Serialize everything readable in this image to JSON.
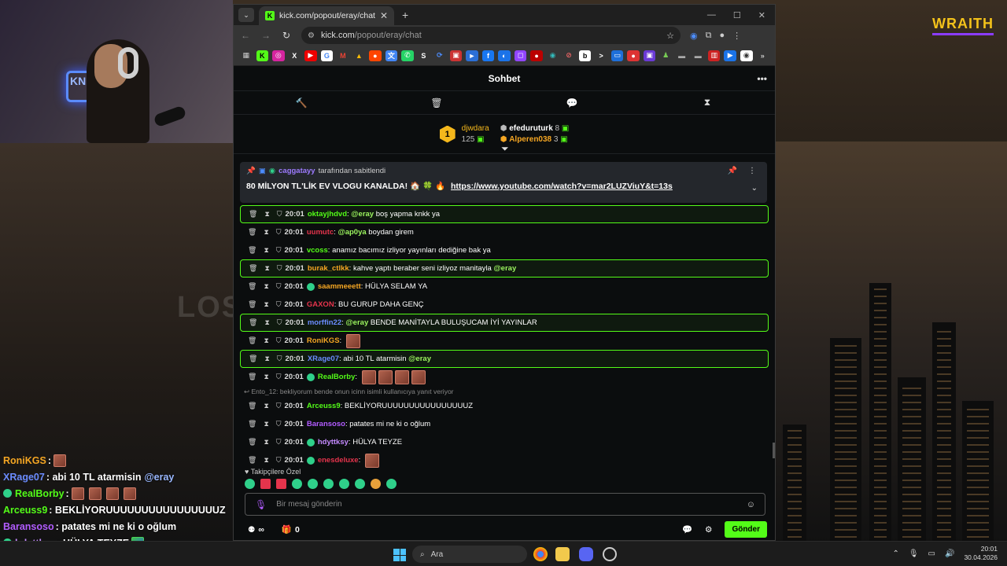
{
  "brand": "WRAITH",
  "overlay_chat": [
    {
      "user": "RoniKGS",
      "color": "#f5a623",
      "text": ":",
      "emotes": 1,
      "badge": false
    },
    {
      "user": "XRage07",
      "color": "#6b8cff",
      "text": ": abi 10 TL atarmisin",
      "mention": "@eray",
      "badge": false
    },
    {
      "user": "RealBorby",
      "color": "#53fc18",
      "text": ":",
      "emotes": 4,
      "badge": true
    },
    {
      "user": "Arceuss9",
      "color": "#53fc18",
      "text": ": BEKLİYORUUUUUUUUUUUUUUUUZ",
      "badge": false
    },
    {
      "user": "Baransoso",
      "color": "#b25cff",
      "text": ": patates mi ne ki o oğlum",
      "badge": false
    },
    {
      "user": "hdyttksy",
      "color": "#c58bff",
      "text": ": HÜLYA TEYZE",
      "frog": true,
      "badge": true
    },
    {
      "user": "enesdeluxe",
      "color": "#e5344c",
      "text": ":",
      "emotes": 1,
      "badge": true
    }
  ],
  "browser": {
    "tab_title": "kick.com/popout/eray/chat",
    "url_host": "kick.com",
    "url_path": "/popout/eray/chat"
  },
  "chat": {
    "title": "Sohbet",
    "leaderboard": {
      "first": {
        "rank": "1",
        "name": "djwdara",
        "count": "125"
      },
      "second": {
        "name": "efeduruturk",
        "count": "8"
      },
      "third": {
        "name": "Alperen038",
        "count": "3"
      }
    },
    "pinned": {
      "by_user": "caggatayy",
      "by_text": "tarafından sabitlendi",
      "message": "80 MİLYON TL'LİK EV VLOGU KANALDA! 🏠 🍀 🔥",
      "link": "https://www.youtube.com/watch?v=mar2LUZViuY&t=13s"
    },
    "messages": [
      {
        "time": "20:01",
        "user": "oktayjhdvd",
        "color": "#53fc18",
        "mention": "@eray",
        "text": "boş yapma knkk ya",
        "hl": true
      },
      {
        "time": "20:01",
        "user": "uumutc",
        "color": "#e5344c",
        "mention": "@ap0ya",
        "text": "boydan girem",
        "hl": false
      },
      {
        "time": "20:01",
        "user": "vcoss",
        "color": "#53fc18",
        "mention": "",
        "text": "anamız bacımız izliyor yayınları dediğine bak ya",
        "hl": false
      },
      {
        "time": "20:01",
        "user": "burak_ctlkk",
        "color": "#f5a623",
        "mention": "",
        "text": "kahve yaptı beraber seni izliyoz manitayla",
        "mention_end": "@eray",
        "hl": true
      },
      {
        "time": "20:01",
        "user": "saammeeett",
        "color": "#f5a623",
        "mention": "",
        "text": "HÜLYA SELAM YA",
        "badge": true,
        "hl": false
      },
      {
        "time": "20:01",
        "user": "GAXON",
        "color": "#e5344c",
        "mention": "",
        "text": "BU GURUP DAHA GENÇ",
        "hl": false
      },
      {
        "time": "20:01",
        "user": "morffin22",
        "color": "#6b8cff",
        "mention": "@eray",
        "text": "BENDE MANİTAYLA BULUŞUCAM İYİ YAYINLAR",
        "hl": true
      },
      {
        "time": "20:01",
        "user": "RoniKGS",
        "color": "#f5a623",
        "mention": "",
        "text": "",
        "emotes": 1,
        "hl": false
      },
      {
        "time": "20:01",
        "user": "XRage07",
        "color": "#6b8cff",
        "mention": "",
        "text": "abi 10 TL atarmisin",
        "mention_end": "@eray",
        "hl": true
      },
      {
        "time": "20:01",
        "user": "RealBorby",
        "color": "#53fc18",
        "mention": "",
        "text": "",
        "emotes": 4,
        "badge": true,
        "hl": false
      }
    ],
    "reply_hint": "Ento_12: bekliyorum bende onun icinn isimli kullanıcıya yanıt veriyor",
    "messages2": [
      {
        "time": "20:01",
        "user": "Arceuss9",
        "color": "#53fc18",
        "text": "BEKLİYORUUUUUUUUUUUUUUUUZ"
      },
      {
        "time": "20:01",
        "user": "Baransoso",
        "color": "#b25cff",
        "text": "patates mi ne ki o oğlum"
      },
      {
        "time": "20:01",
        "user": "hdyttksy",
        "color": "#c58bff",
        "text": "HÜLYA TEYZE",
        "badge": true
      },
      {
        "time": "20:01",
        "user": "enesdeluxe",
        "color": "#e5344c",
        "text": "",
        "badge": true,
        "emotes": 1
      }
    ],
    "followers_label": "Takipçilere Özel",
    "input_placeholder": "Bir mesaj gönderin",
    "points": "∞",
    "gifts": "0",
    "send_label": "Gönder"
  },
  "taskbar": {
    "search": "Ara",
    "time": "20:01",
    "date": "30.04.2026"
  }
}
